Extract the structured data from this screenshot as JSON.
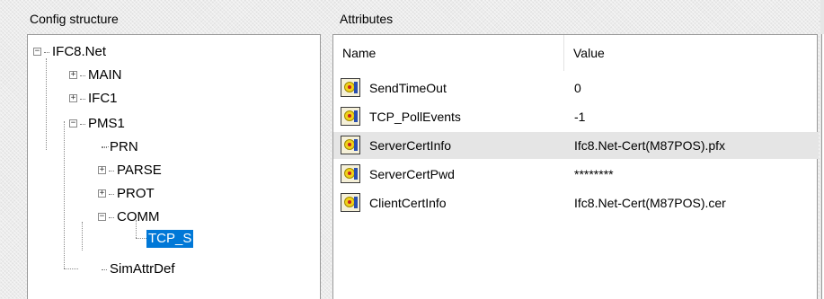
{
  "config_panel": {
    "title": "Config structure",
    "tree": {
      "root": "IFC8.Net",
      "main": "MAIN",
      "ifc1": "IFC1",
      "pms1": "PMS1",
      "prn": "PRN",
      "parse": "PARSE",
      "prot": "PROT",
      "comm": "COMM",
      "tcp_s": "TCP_S",
      "simattrdef": "SimAttrDef"
    },
    "selected_node": "TCP_S"
  },
  "attributes_panel": {
    "title": "Attributes",
    "columns": {
      "name": "Name",
      "value": "Value"
    },
    "rows": [
      {
        "name": "SendTimeOut",
        "value": "0",
        "icon": "attribute-icon"
      },
      {
        "name": "TCP_PollEvents",
        "value": "-1",
        "icon": "attribute-icon"
      },
      {
        "name": "ServerCertInfo",
        "value": "Ifc8.Net-Cert(M87POS).pfx",
        "icon": "attribute-icon",
        "selected": true
      },
      {
        "name": "ServerCertPwd",
        "value": "********",
        "icon": "attribute-icon"
      },
      {
        "name": "ClientCertInfo",
        "value": "Ifc8.Net-Cert(M87POS).cer",
        "icon": "attribute-icon"
      }
    ]
  },
  "right_panel": {
    "title_fragment": "S"
  },
  "icons": {
    "expanded": "minus-box-icon",
    "collapsed": "plus-box-icon"
  },
  "colors": {
    "selection": "#0078d7",
    "row_highlight": "#e5e5e5"
  }
}
